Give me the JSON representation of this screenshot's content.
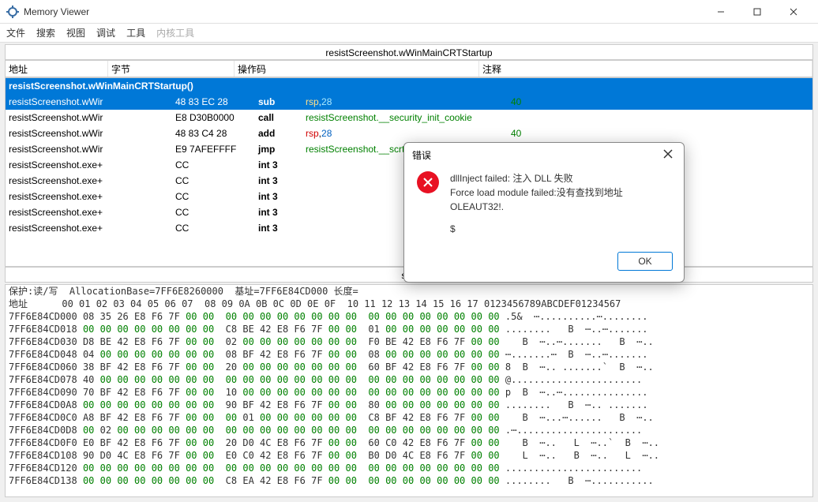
{
  "titlebar": {
    "title": "Memory Viewer"
  },
  "menubar": {
    "file": "文件",
    "search": "搜索",
    "view": "视图",
    "debug": "调试",
    "tools": "工具",
    "kernel": "内核工具"
  },
  "section_title": "resistScreenshot.wWinMainCRTStartup",
  "cols": {
    "addr": "地址",
    "bytes": "字节",
    "opcode": "操作码",
    "comment": "注释"
  },
  "disasm": {
    "func": "resistScreenshot.wWinMainCRTStartup()",
    "rows": [
      {
        "addr": "resistScreenshot.wWir",
        "bytes": "48 83 EC 28",
        "mn": "sub",
        "op_reg": "rsp",
        "op_sep": ",",
        "op_num": "28",
        "cmt": "40",
        "sel": true
      },
      {
        "addr": "resistScreenshot.wWir",
        "bytes": "E8 D30B0000",
        "mn": "call",
        "sym": "resistScreenshot.__security_init_cookie"
      },
      {
        "addr": "resistScreenshot.wWir",
        "bytes": "48 83 C4 28",
        "mn": "add",
        "op_reg": "rsp",
        "op_sep": ",",
        "op_num": "28",
        "cmt": "40"
      },
      {
        "addr": "resistScreenshot.wWir",
        "bytes": "E9 7AFEFFFF",
        "mn": "jmp",
        "sym": "resistScreenshot.__scrt_c"
      },
      {
        "addr": "resistScreenshot.exe+",
        "bytes": "CC",
        "mn": "int 3"
      },
      {
        "addr": "resistScreenshot.exe+",
        "bytes": "CC",
        "mn": "int 3"
      },
      {
        "addr": "resistScreenshot.exe+",
        "bytes": "CC",
        "mn": "int 3"
      },
      {
        "addr": "resistScreenshot.exe+",
        "bytes": "CC",
        "mn": "int 3"
      },
      {
        "addr": "resistScreenshot.exe+",
        "bytes": "CC",
        "mn": "int 3"
      }
    ]
  },
  "midbar": "sub",
  "hex": {
    "info": "保护:读/写  AllocationBase=7FF6E8260000  基址=7FF6E84CD000 长度=",
    "hdr_addr": "地址",
    "hdr_cols": "      00 01 02 03 04 05 06 07  08 09 0A 0B 0C 0D 0E 0F  10 11 12 13 14 15 16 17 0123456789ABCDEF01234567",
    "lines": [
      "7FF6E84CD000 08 35 26 E8 F6 7F 00 00  00 00 00 00 00 00 00 00  00 00 00 00 00 00 00 00 .5&  ⋯..........⋯........",
      "7FF6E84CD018 00 00 00 00 00 00 00 00  C8 BE 42 E8 F6 7F 00 00  01 00 00 00 00 00 00 00 ........   B  ⋯..⋯.......",
      "7FF6E84CD030 D8 BE 42 E8 F6 7F 00 00  02 00 00 00 00 00 00 00  F0 BE 42 E8 F6 7F 00 00    B  ⋯..⋯.......   B  ⋯..",
      "7FF6E84CD048 04 00 00 00 00 00 00 00  08 BF 42 E8 F6 7F 00 00  08 00 00 00 00 00 00 00 ⋯.......⋯  B  ⋯..⋯.......",
      "7FF6E84CD060 38 BF 42 E8 F6 7F 00 00  20 00 00 00 00 00 00 00  60 BF 42 E8 F6 7F 00 00 8  B  ⋯.. .......`  B  ⋯..",
      "7FF6E84CD078 40 00 00 00 00 00 00 00  00 00 00 00 00 00 00 00  00 00 00 00 00 00 00 00 @.......................",
      "7FF6E84CD090 70 BF 42 E8 F6 7F 00 00  10 00 00 00 00 00 00 00  00 00 00 00 00 00 00 00 p  B  ⋯..⋯...............",
      "7FF6E84CD0A8 00 00 00 00 00 00 00 00  90 BF 42 E8 F6 7F 00 00  80 00 00 00 00 00 00 00 ........   B  ⋯.. .......",
      "7FF6E84CD0C0 A8 BF 42 E8 F6 7F 00 00  00 01 00 00 00 00 00 00  C8 BF 42 E8 F6 7F 00 00    B  ⋯...⋯......   B  ⋯..",
      "7FF6E84CD0D8 00 02 00 00 00 00 00 00  00 00 00 00 00 00 00 00  00 00 00 00 00 00 00 00 .⋯......................",
      "7FF6E84CD0F0 E0 BF 42 E8 F6 7F 00 00  20 D0 4C E8 F6 7F 00 00  60 C0 42 E8 F6 7F 00 00    B  ⋯..   L  ⋯..`  B  ⋯..",
      "7FF6E84CD108 90 D0 4C E8 F6 7F 00 00  E0 C0 42 E8 F6 7F 00 00  B0 D0 4C E8 F6 7F 00 00    L  ⋯..   B  ⋯..   L  ⋯..",
      "7FF6E84CD120 00 00 00 00 00 00 00 00  00 00 00 00 00 00 00 00  00 00 00 00 00 00 00 00 ........................",
      "7FF6E84CD138 00 00 00 00 00 00 00 00  C8 EA 42 E8 F6 7F 00 00  00 00 00 00 00 00 00 00 ........   B  ⋯..........."
    ]
  },
  "dialog": {
    "title": "错误",
    "line1": "dllInject failed: 注入 DLL 失败",
    "line2": "Force load module failed:没有查找到地址",
    "line3": "OLEAUT32!.",
    "line4": "$",
    "ok": "OK"
  }
}
